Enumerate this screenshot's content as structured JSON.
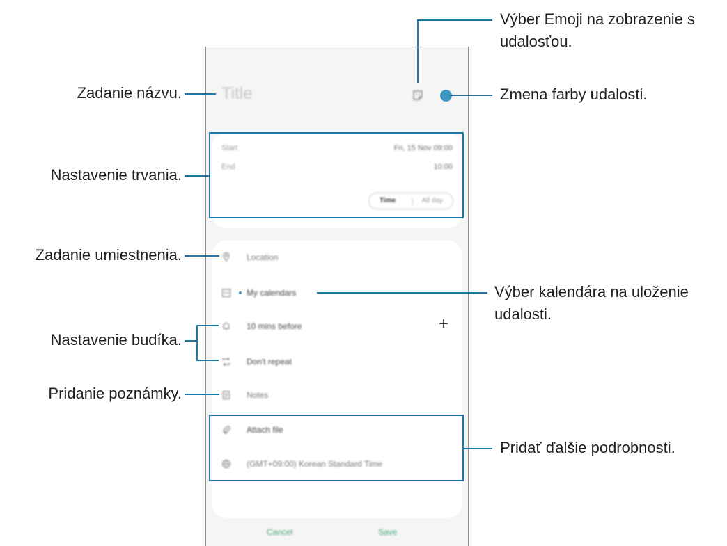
{
  "event_form": {
    "title_placeholder": "Title",
    "emoji_icon": "sticker-icon",
    "color_hex": "#3e97c2",
    "start_label": "Start",
    "start_value": "Fri, 15 Nov 09:00",
    "end_label": "End",
    "end_value": "10:00",
    "time_toggle": "Time",
    "allday_toggle": "All day",
    "location_placeholder": "Location",
    "calendar_value": "My calendars",
    "reminder_value": "10 mins before",
    "repeat_value": "Don't repeat",
    "notes_placeholder": "Notes",
    "attach_file_label": "Attach file",
    "timezone_value": "(GMT+09:00) Korean Standard Time",
    "add_symbol": "+",
    "cancel_label": "Cancel",
    "save_label": "Save"
  },
  "callouts": {
    "title": "Zadanie názvu.",
    "duration": "Nastavenie trvania.",
    "location": "Zadanie umiestnenia.",
    "alarm": "Nastavenie budíka.",
    "notes": "Pridanie poznámky.",
    "emoji_line1": "Výber Emoji na zobrazenie s",
    "emoji_line2": "udalosťou.",
    "color": "Zmena farby udalosti.",
    "calendar_line1": "Výber kalendára na uloženie",
    "calendar_line2": "udalosti.",
    "details": "Pridať ďalšie podrobnosti."
  },
  "colors": {
    "callout_line": "#1f78a6",
    "accent": "#3e97c2",
    "footer_action": "#4aa57c"
  }
}
